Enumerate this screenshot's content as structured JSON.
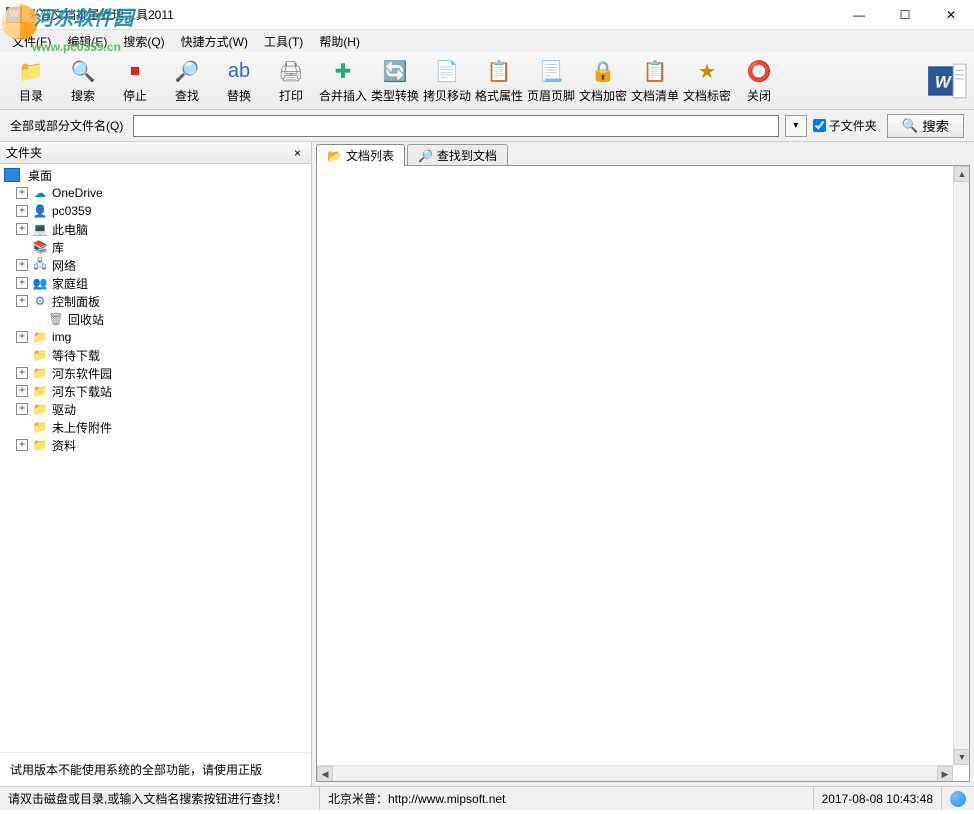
{
  "title": "米普文档批量处理工具2011",
  "watermark": {
    "text": "河东软件园",
    "url": "www.pc0359.cn"
  },
  "win_controls": {
    "min": "—",
    "max": "☐",
    "close": "✕"
  },
  "menus": [
    {
      "label": "文件(F)"
    },
    {
      "label": "编辑(E)"
    },
    {
      "label": "搜索(Q)"
    },
    {
      "label": "快捷方式(W)"
    },
    {
      "label": "工具(T)"
    },
    {
      "label": "帮助(H)"
    }
  ],
  "toolbar": [
    {
      "name": "directory",
      "label": "目录",
      "color": "#3a9",
      "glyph": "📁"
    },
    {
      "name": "search",
      "label": "搜索",
      "color": "#d33",
      "glyph": "🔍"
    },
    {
      "name": "stop",
      "label": "停止",
      "color": "#d22",
      "glyph": "⏹"
    },
    {
      "name": "find",
      "label": "查找",
      "color": "#36c",
      "glyph": "🔎"
    },
    {
      "name": "replace",
      "label": "替换",
      "color": "#36c",
      "glyph": "ab"
    },
    {
      "name": "print",
      "label": "打印",
      "color": "#888",
      "glyph": "🖨"
    },
    {
      "name": "merge-insert",
      "label": "合并插入",
      "color": "#2a7",
      "glyph": "✚"
    },
    {
      "name": "type-convert",
      "label": "类型转换",
      "color": "#39d",
      "glyph": "🔄"
    },
    {
      "name": "copy-move",
      "label": "拷贝移动",
      "color": "#39d",
      "glyph": "📄"
    },
    {
      "name": "format-attr",
      "label": "格式属性",
      "color": "#c80",
      "glyph": "📋"
    },
    {
      "name": "header-footer",
      "label": "页眉页脚",
      "color": "#39d",
      "glyph": "📃"
    },
    {
      "name": "doc-encrypt",
      "label": "文档加密",
      "color": "#c80",
      "glyph": "🔒"
    },
    {
      "name": "doc-list",
      "label": "文档清单",
      "color": "#39d",
      "glyph": "📋"
    },
    {
      "name": "doc-secret",
      "label": "文档标密",
      "color": "#c80",
      "glyph": "★"
    },
    {
      "name": "close",
      "label": "关闭",
      "color": "#d22",
      "glyph": "⭕"
    }
  ],
  "searchbar": {
    "label": "全部或部分文件名(Q)",
    "value": "",
    "subfolder_label": "子文件夹",
    "subfolder_checked": true,
    "search_btn": "搜索"
  },
  "left_pane": {
    "title": "文件夹",
    "root": "桌面",
    "items": [
      {
        "label": "OneDrive",
        "icon": "☁",
        "color": "#0a84d8",
        "expandable": true
      },
      {
        "label": "pc0359",
        "icon": "👤",
        "color": "#555",
        "expandable": true
      },
      {
        "label": "此电脑",
        "icon": "💻",
        "color": "#3478c8",
        "expandable": true
      },
      {
        "label": "库",
        "icon": "📚",
        "color": "#3aa0d8",
        "expandable": false
      },
      {
        "label": "网络",
        "icon": "🖧",
        "color": "#3478c8",
        "expandable": true
      },
      {
        "label": "家庭组",
        "icon": "👥",
        "color": "#2a8",
        "expandable": true
      },
      {
        "label": "控制面板",
        "icon": "⚙",
        "color": "#3478c8",
        "expandable": true
      },
      {
        "label": "回收站",
        "icon": "🗑",
        "color": "#888",
        "expandable": false,
        "indent": true
      },
      {
        "label": "img",
        "icon": "📁",
        "color": "#e6b800",
        "expandable": true
      },
      {
        "label": "等待下载",
        "icon": "📁",
        "color": "#e6b800",
        "expandable": false
      },
      {
        "label": "河东软件园",
        "icon": "📁",
        "color": "#e6b800",
        "expandable": true
      },
      {
        "label": "河东下载站",
        "icon": "📁",
        "color": "#e6b800",
        "expandable": true
      },
      {
        "label": "驱动",
        "icon": "📁",
        "color": "#e6b800",
        "expandable": true
      },
      {
        "label": "未上传附件",
        "icon": "📁",
        "color": "#e6b800",
        "expandable": false
      },
      {
        "label": "资料",
        "icon": "📁",
        "color": "#e6b800",
        "expandable": true
      }
    ],
    "trial_note": "试用版本不能使用系统的全部功能，请使用正版"
  },
  "right_pane": {
    "tabs": [
      {
        "name": "doc-list-tab",
        "label": "文档列表",
        "icon": "📂",
        "active": true
      },
      {
        "name": "found-docs-tab",
        "label": "查找到文档",
        "icon": "🔎",
        "active": false
      }
    ]
  },
  "statusbar": {
    "hint": "请双击磁盘或目录,或输入文档名搜索按钮进行查找！",
    "company": "北京米普：http://www.mipsoft.net",
    "datetime": "2017-08-08 10:43:48"
  }
}
